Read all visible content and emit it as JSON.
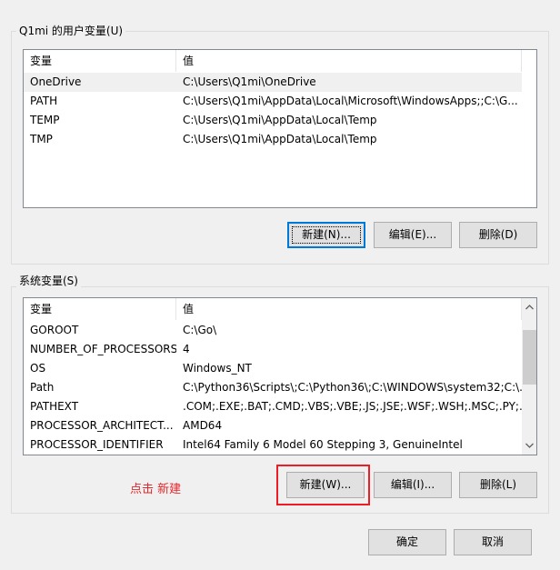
{
  "user_vars": {
    "group_title": "Q1mi 的用户变量(U)",
    "columns": [
      "变量",
      "值"
    ],
    "rows": [
      {
        "name": "OneDrive",
        "value": "C:\\Users\\Q1mi\\OneDrive"
      },
      {
        "name": "PATH",
        "value": "C:\\Users\\Q1mi\\AppData\\Local\\Microsoft\\WindowsApps;;C:\\G..."
      },
      {
        "name": "TEMP",
        "value": "C:\\Users\\Q1mi\\AppData\\Local\\Temp"
      },
      {
        "name": "TMP",
        "value": "C:\\Users\\Q1mi\\AppData\\Local\\Temp"
      }
    ],
    "selected_index": 0,
    "buttons": {
      "new": "新建(N)...",
      "edit": "编辑(E)...",
      "delete": "删除(D)"
    }
  },
  "system_vars": {
    "group_title": "系统变量(S)",
    "columns": [
      "变量",
      "值"
    ],
    "rows": [
      {
        "name": "GOROOT",
        "value": "C:\\Go\\"
      },
      {
        "name": "NUMBER_OF_PROCESSORS",
        "value": "4"
      },
      {
        "name": "OS",
        "value": "Windows_NT"
      },
      {
        "name": "Path",
        "value": "C:\\Python36\\Scripts\\;C:\\Python36\\;C:\\WINDOWS\\system32;C:\\..."
      },
      {
        "name": "PATHEXT",
        "value": ".COM;.EXE;.BAT;.CMD;.VBS;.VBE;.JS;.JSE;.WSF;.WSH;.MSC;.PY;.P..."
      },
      {
        "name": "PROCESSOR_ARCHITECT...",
        "value": "AMD64"
      },
      {
        "name": "PROCESSOR_IDENTIFIER",
        "value": "Intel64 Family 6 Model 60 Stepping 3, GenuineIntel"
      }
    ],
    "buttons": {
      "new": "新建(W)...",
      "edit": "编辑(I)...",
      "delete": "删除(L)"
    }
  },
  "annotation": "点击 新建",
  "footer": {
    "ok": "确定",
    "cancel": "取消"
  },
  "colors": {
    "highlight": "#ee1c25",
    "annotation": "#e5262b",
    "default_button_border": "#0078d7"
  }
}
